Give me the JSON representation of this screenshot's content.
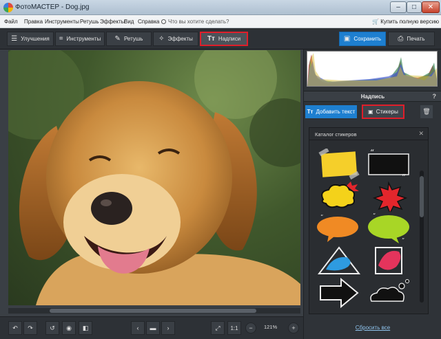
{
  "window": {
    "title": "ФотоМАСТЕР - Dog.jpg",
    "minimize_glyph": "‒",
    "maximize_glyph": "□",
    "close_glyph": "✕"
  },
  "menu": {
    "items": [
      "Файл",
      "Правка",
      "Инструменты",
      "Ретушь",
      "Эффекты",
      "Вид",
      "Справка"
    ],
    "search_placeholder": "Что вы хотите сделать?",
    "buy_label": "Купить полную версию"
  },
  "toolbar": {
    "tabs": [
      {
        "label": "Улучшения",
        "icon": "sliders-icon"
      },
      {
        "label": "Инструменты",
        "icon": "crop-icon"
      },
      {
        "label": "Ретушь",
        "icon": "brush-icon"
      },
      {
        "label": "Эффекты",
        "icon": "magic-wand-icon"
      },
      {
        "label": "Надписи",
        "icon": "text-icon",
        "active": true
      }
    ],
    "save_label": "Сохранить",
    "print_label": "Печать"
  },
  "panel": {
    "section_title": "Надпись",
    "help_glyph": "?",
    "add_text_label": "Добавить текст",
    "stickers_label": "Стикеры",
    "catalog_title": "Каталог стикеров",
    "catalog_close_glyph": "✕",
    "reset_label": "Сбросить все"
  },
  "bottombar": {
    "ratio_label": "1:1",
    "zoom_value": "121%"
  },
  "colors": {
    "accent_blue": "#1e7fd0",
    "highlight_red": "#e01e2a",
    "panel_dark": "#2f3338"
  }
}
